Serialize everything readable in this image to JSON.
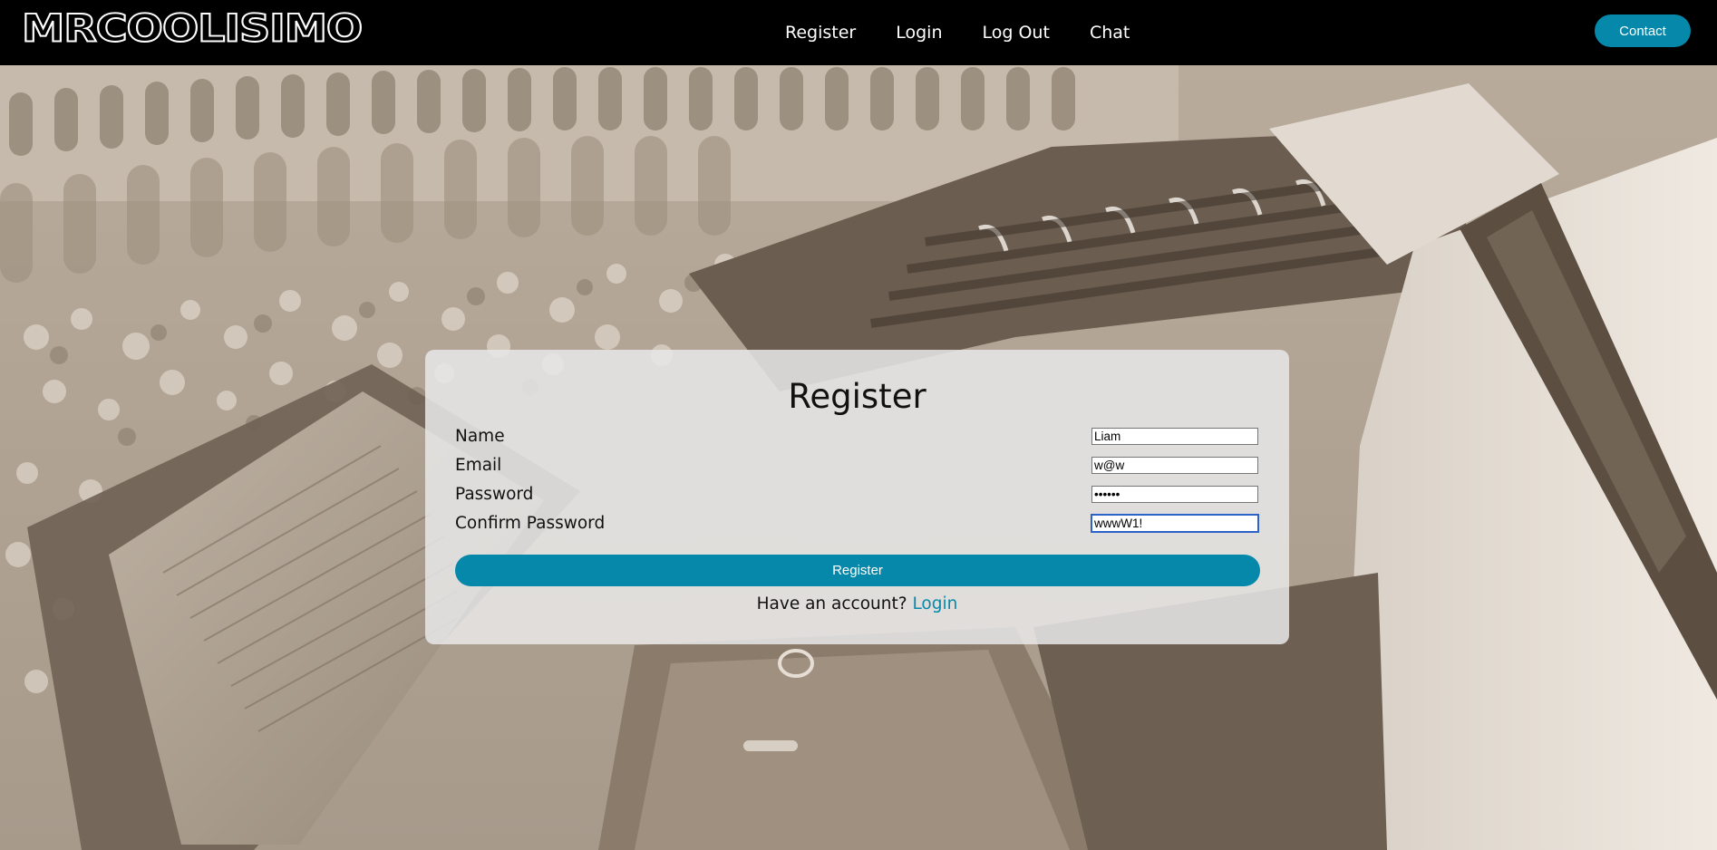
{
  "brand": {
    "name": "MRCOOLISIMO"
  },
  "nav": {
    "links": [
      {
        "label": "Register"
      },
      {
        "label": "Login"
      },
      {
        "label": "Log Out"
      },
      {
        "label": "Chat"
      }
    ],
    "contact_label": "Contact"
  },
  "form": {
    "title": "Register",
    "fields": [
      {
        "label": "Name",
        "value": "Liam",
        "type": "text"
      },
      {
        "label": "Email",
        "value": "w@w",
        "type": "text"
      },
      {
        "label": "Password",
        "value": "wwwW1!",
        "type": "password"
      },
      {
        "label": "Confirm Password",
        "value": "wwwW1!",
        "type": "text"
      }
    ],
    "submit_label": "Register",
    "alt_prompt": "Have an account?",
    "alt_link": "Login"
  },
  "colors": {
    "accent": "#0588aa",
    "navbar": "#000000",
    "card": "#e8e8e8",
    "photo_tone": "#b3a698"
  }
}
